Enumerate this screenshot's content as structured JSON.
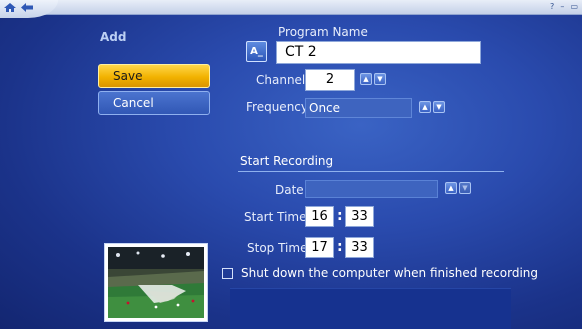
{
  "window": {
    "back_icon": "back-arrow-icon",
    "home_icon": "windows-media-center-icon",
    "controls": {
      "help": "?",
      "minimize": "–",
      "restore": "▭"
    }
  },
  "header": {
    "title": "Add"
  },
  "actions": {
    "save_label": "Save",
    "cancel_label": "Cancel"
  },
  "program": {
    "name_label": "Program Name",
    "name_value": "CT 2",
    "keyboard_icon_glyph": "A_"
  },
  "channel": {
    "label": "Channel",
    "value": "2"
  },
  "frequency": {
    "label": "Frequency",
    "value": "Once"
  },
  "start_recording": {
    "section_title": "Start Recording",
    "date_label": "Date",
    "date_value": "",
    "start_time_label": "Start Time",
    "start_hour": "16",
    "start_minute": "33",
    "stop_time_label": "Stop Time",
    "stop_hour": "17",
    "stop_minute": "33",
    "time_separator": ":"
  },
  "shutdown": {
    "label": "Shut down the computer when finished recording",
    "checked": false
  },
  "spinner": {
    "up": "▲",
    "down": "▼"
  },
  "colors": {
    "accent_yellow": "#f2b200",
    "background_blue": "#2a4bae",
    "field_blue": "#3e64bf"
  }
}
